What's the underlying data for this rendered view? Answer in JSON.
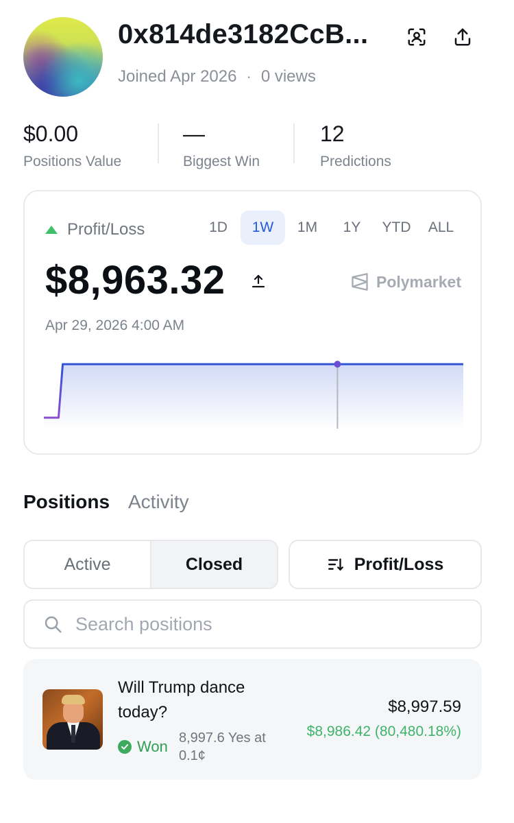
{
  "profile": {
    "address": "0x814de3182CcB...",
    "joined": "Joined Apr 2026",
    "views": "0 views"
  },
  "stats": [
    {
      "value": "$0.00",
      "label": "Positions Value"
    },
    {
      "value": "—",
      "label": "Biggest Win"
    },
    {
      "value": "12",
      "label": "Predictions"
    }
  ],
  "pl_card": {
    "title": "Profit/Loss",
    "ranges": [
      "1D",
      "1W",
      "1M",
      "1Y",
      "YTD",
      "ALL"
    ],
    "selected_range": "1W",
    "value": "$8,963.32",
    "brand": "Polymarket",
    "timestamp": "Apr 29, 2026 4:00 AM",
    "up_color": "#3fbf6a",
    "line_color": "#2f55d4"
  },
  "chart_data": {
    "type": "area",
    "series": [
      {
        "x": [
          0,
          0.035,
          0.045,
          0.7,
          1.0
        ],
        "values": [
          0,
          0,
          8963.32,
          8963.32,
          8963.32
        ]
      }
    ],
    "highlight_index": 3,
    "xlabel": "",
    "ylabel": "",
    "grid": false
  },
  "tabs": {
    "positions": "Positions",
    "activity": "Activity"
  },
  "filters": {
    "active": "Active",
    "closed": "Closed",
    "sort_label": "Profit/Loss"
  },
  "search": {
    "placeholder": "Search positions",
    "value": ""
  },
  "positions": [
    {
      "title": "Will Trump dance today?",
      "status": "Won",
      "shares": "8,997.6 Yes at 0.1¢",
      "value": "$8,997.59",
      "pnl": "$8,986.42 (80,480.18%)"
    }
  ]
}
